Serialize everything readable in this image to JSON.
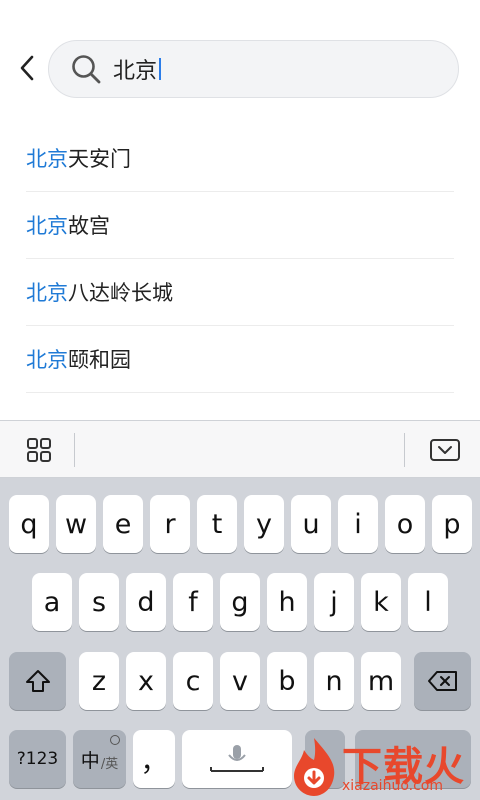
{
  "search": {
    "query": "北京"
  },
  "suggestions": [
    {
      "highlight": "北京",
      "rest": "天安门"
    },
    {
      "highlight": "北京",
      "rest": "故宫"
    },
    {
      "highlight": "北京",
      "rest": "八达岭长城"
    },
    {
      "highlight": "北京",
      "rest": "颐和园"
    }
  ],
  "keyboard": {
    "row1": [
      "q",
      "w",
      "e",
      "r",
      "t",
      "y",
      "u",
      "i",
      "o",
      "p"
    ],
    "row2": [
      "a",
      "s",
      "d",
      "f",
      "g",
      "h",
      "j",
      "k",
      "l"
    ],
    "row3": [
      "z",
      "x",
      "c",
      "v",
      "b",
      "n",
      "m"
    ],
    "numbers_label": "?123",
    "lang_main": "中",
    "lang_sub": "/英",
    "comma_label": "，"
  },
  "watermark": {
    "text": "下载火",
    "url": "xiazaihuo.com"
  },
  "colors": {
    "highlight": "#1f7ad6",
    "keyboard_bg": "#d1d4da",
    "watermark": "#e8482c"
  }
}
